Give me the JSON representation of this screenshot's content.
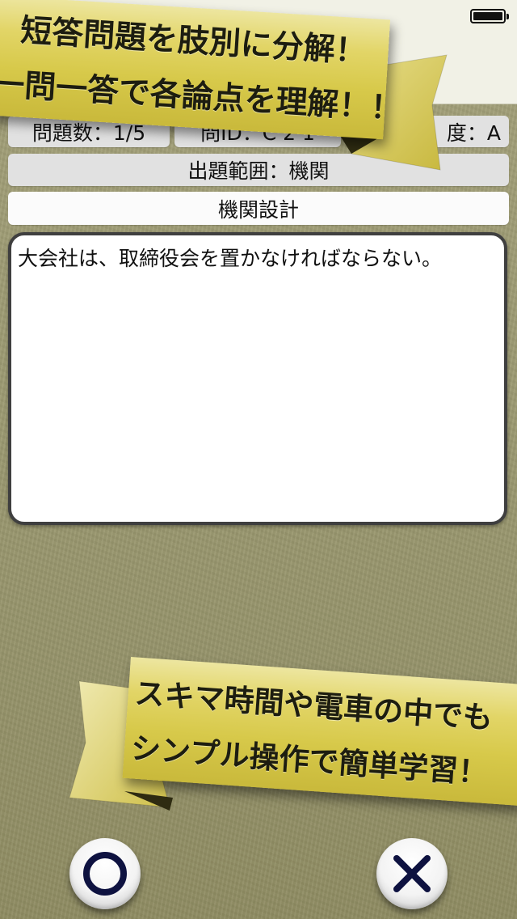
{
  "status_bar": {
    "battery_icon": "battery-full-icon"
  },
  "info_row": {
    "question_count": "問題数：1/5",
    "question_id": "問ID：C 2 1",
    "difficulty": "度：A"
  },
  "range_label": "出題範囲：機関",
  "subject": "機関設計",
  "question_text": "大会社は、取締役会を置かなければならない。",
  "top_banner": {
    "line1": "短答問題を肢別に分解！",
    "line2": "一問一答で各論点を理解！！",
    "color": "#dccf55"
  },
  "bottom_banner": {
    "line1": "スキマ時間や電車の中でも",
    "line2": "シンプル操作で簡単学習！",
    "color": "#dccf55"
  },
  "buttons": {
    "correct_icon": "circle-icon",
    "wrong_icon": "cross-icon",
    "correct_color": "#0e1240",
    "wrong_color": "#0e1240"
  }
}
